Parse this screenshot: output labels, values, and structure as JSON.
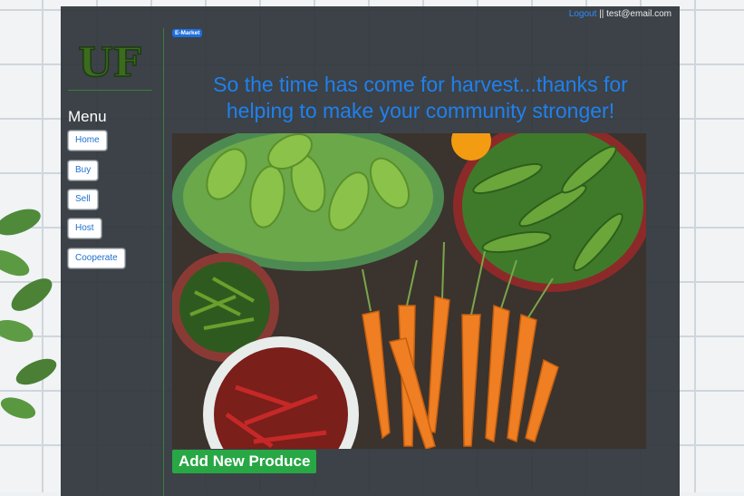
{
  "header": {
    "logout_label": "Logout",
    "separator": "||",
    "user_email": "test@email.com"
  },
  "logo": {
    "text": "UF"
  },
  "brand_badge": "E-Market",
  "menu": {
    "title": "Menu",
    "items": [
      {
        "label": "Home"
      },
      {
        "label": "Buy"
      },
      {
        "label": "Sell"
      },
      {
        "label": "Host"
      },
      {
        "label": "Cooperate"
      }
    ]
  },
  "main": {
    "headline_line1": "So the time has come for harvest...thanks for",
    "headline_line2": "helping to make your community stronger!",
    "hero_image": "harvest-produce-photo",
    "add_button_label": "Add New Produce"
  },
  "colors": {
    "panel": "#343a40",
    "accent_blue": "#1f80ef",
    "add_button": "#28a745",
    "divider_green": "#3a7f3a"
  }
}
